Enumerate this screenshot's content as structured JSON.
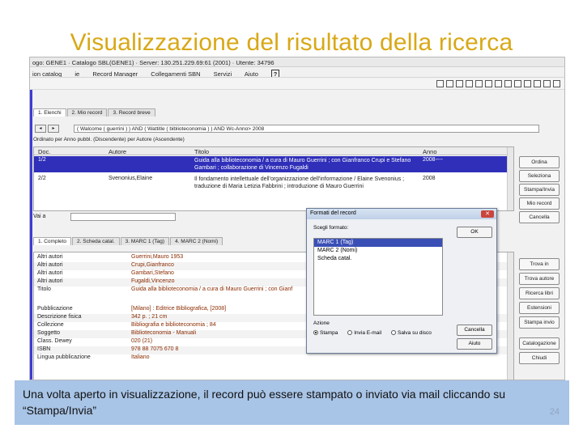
{
  "slide": {
    "title": "Visualizzazione del risultato della ricerca",
    "caption": "Una volta aperto in visualizzazione, il  record può essere stampato o inviato via mail cliccando su “Stampa/Invia”",
    "page_number": "24"
  },
  "app": {
    "status_line": "ogo: GENE1 · Catalogo SBL(GENE1) · Server: 130.251.229.69:61 (2001) · Utente: 34796",
    "menu": [
      "ion catalog",
      "ie",
      "Record Manager",
      "Collegamenti SBN",
      "Servizi",
      "Aiuto"
    ],
    "help_label": "?",
    "tabs_top": [
      "1. Elenchi",
      "2. Mio record",
      "3. Record breve"
    ],
    "search_string": "( Walcome ( guerrini ) ) AND ( Wattitle ( biblioteconomia ) ) AND Wc-Anno> 2008",
    "order_line": "Ordinato per Anno pubbl. (Discendente) per Autore (Ascendente)",
    "grid": {
      "headers": [
        "Doc.",
        "Autore",
        "Titolo",
        "Anno"
      ],
      "rows": [
        {
          "doc": "1/2",
          "author": "",
          "title": "Guida alla biblioteconomia / a cura di Mauro Guerrini ; con Gianfranco Crupi e Stefano Gambari ; collaborazione di Vincenzo Fugaldi",
          "year": "2008----"
        },
        {
          "doc": "2/2",
          "author": "Svenonius,Elaine",
          "title": "Il fondamento intellettuale dell'organizzazione dell'informazione / Elaine Svenonius ; traduzione di Maria Letizia Fabbrini ; introduzione di Mauro Guerrini",
          "year": "2008"
        }
      ]
    },
    "right_buttons": [
      "Ordina",
      "Seleziona",
      "Stampa/Invia",
      "Mio record",
      "Cancella"
    ],
    "vai_label": "Vai a",
    "detail_tabs": [
      "1. Completo",
      "2. Scheda catal.",
      "3. MARC 1 (Tag)",
      "4. MARC 2 (Nomi)"
    ],
    "detail_rows": [
      {
        "label": "Altri autori",
        "value": "Guerrini,Mauro 1953"
      },
      {
        "label": "Altri autori",
        "value": "Crupi,Gianfranco"
      },
      {
        "label": "Altri autori",
        "value": "Gambari,Stefano"
      },
      {
        "label": "Altri autori",
        "value": "Fugaldi,Vincenzo"
      },
      {
        "label": "Titolo",
        "value": "Guida alla biblioteconomia / a cura di Mauro Guerrini ; con Gianf"
      },
      {
        "label": "",
        "value": ""
      },
      {
        "label": "Pubblicazione",
        "value": "[Milano] : Editrice Bibliografica, [2008]"
      },
      {
        "label": "Descrizione fisica",
        "value": "342 p. ; 21 cm"
      },
      {
        "label": "Collezione",
        "value": "Bibliografia e biblioteconomia ; 84"
      },
      {
        "label": "Soggetto",
        "value": "Biblioteconomia - Manuali"
      },
      {
        "label": "Class. Dewey",
        "value": "020 (21)"
      },
      {
        "label": "ISBN",
        "value": "978 88 7075 670 8"
      },
      {
        "label": "Lingua pubblicazione",
        "value": "Italiano"
      }
    ],
    "detail_right_buttons": [
      "Trova in",
      "Trova autore",
      "Ricerca libri",
      "Estensioni",
      "Stampa invio",
      "Catalogazione",
      "Chiudi"
    ],
    "dialog": {
      "title": "Formati del record",
      "group_label": "Scegli formato:",
      "formats": [
        "MARC 1 (Tag)",
        "MARC 2 (Nomi)",
        "Scheda catal."
      ],
      "ok": "OK",
      "cancel": "Cancella",
      "help": "Aiuto",
      "action_label": "Azione",
      "actions": [
        "Stampa",
        "Invia E-mail",
        "Salva su disco"
      ]
    }
  }
}
